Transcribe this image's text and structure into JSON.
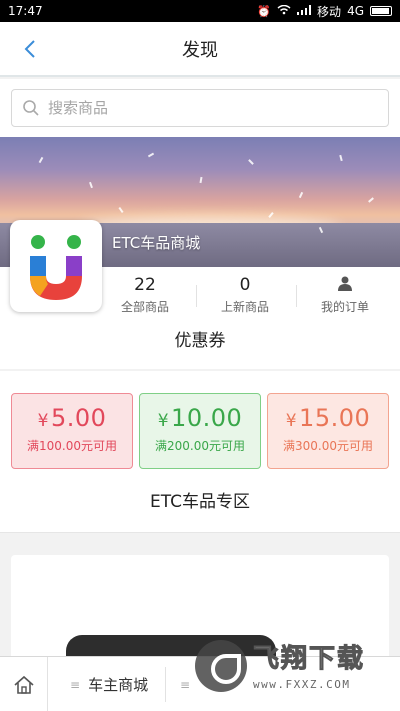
{
  "status_bar": {
    "time": "17:47",
    "carrier": "移动",
    "network": "4G"
  },
  "header": {
    "title": "发现",
    "back_icon": "chevron-left-icon"
  },
  "search": {
    "placeholder": "搜索商品",
    "icon": "search-icon"
  },
  "shop": {
    "name": "ETC车品商城",
    "stats": [
      {
        "value": "22",
        "label": "全部商品"
      },
      {
        "value": "0",
        "label": "上新商品"
      },
      {
        "value": "",
        "label": "我的订单",
        "icon": "user-icon"
      }
    ]
  },
  "coupon_section": {
    "title": "优惠券",
    "coupons": [
      {
        "currency": "¥",
        "amount": "5.00",
        "condition": "满100.00元可用",
        "color": "#e2485b"
      },
      {
        "currency": "¥",
        "amount": "10.00",
        "condition": "满200.00元可用",
        "color": "#3aa74a"
      },
      {
        "currency": "¥",
        "amount": "15.00",
        "condition": "满300.00元可用",
        "color": "#e97556"
      }
    ]
  },
  "zone_section": {
    "title": "ETC车品专区"
  },
  "bottom_bar": {
    "home_icon": "home-icon",
    "items": [
      {
        "label": "车主商城",
        "icon": "menu-icon"
      },
      {
        "label": "",
        "icon": "menu-icon"
      }
    ]
  },
  "watermark": {
    "text": "飞翔下载",
    "url": "www.FXXZ.COM"
  }
}
